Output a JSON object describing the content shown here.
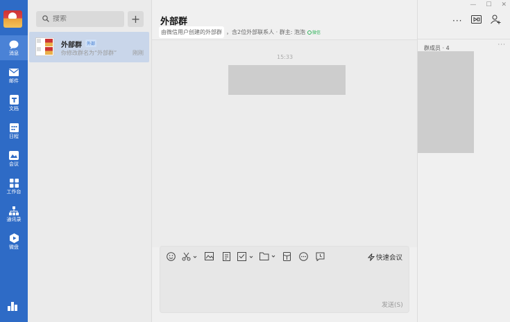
{
  "nav": {
    "items": [
      {
        "label": "消息",
        "icon": "chat-bubble-icon"
      },
      {
        "label": "邮件",
        "icon": "mail-icon"
      },
      {
        "label": "文档",
        "icon": "document-icon"
      },
      {
        "label": "日程",
        "icon": "calendar-icon"
      },
      {
        "label": "会议",
        "icon": "meeting-icon"
      },
      {
        "label": "工作台",
        "icon": "workbench-icon"
      },
      {
        "label": "通讯录",
        "icon": "contacts-icon"
      },
      {
        "label": "微盘",
        "icon": "drive-icon"
      }
    ],
    "active_index": 0
  },
  "list": {
    "search_placeholder": "搜索",
    "add_symbol": "+",
    "conversation": {
      "name": "外部群",
      "tag": "外部",
      "preview": "你修改群名为“外部群”",
      "time": "刚刚"
    }
  },
  "chat": {
    "title": "外部群",
    "subtitle_hl": "由微信用户创建的外部群",
    "subtitle_rest": "，含2位外部联系人 · 群主: 泡泡",
    "wechat_label": "微信",
    "timestamp": "15:33"
  },
  "composer": {
    "meeting_label": "快速会议",
    "send_label": "发送(S)"
  },
  "members": {
    "title": "群成员 · 4",
    "more": "···"
  },
  "header": {
    "more": "···"
  },
  "window": {
    "minimize": "—",
    "maximize": "☐",
    "close": "✕"
  }
}
